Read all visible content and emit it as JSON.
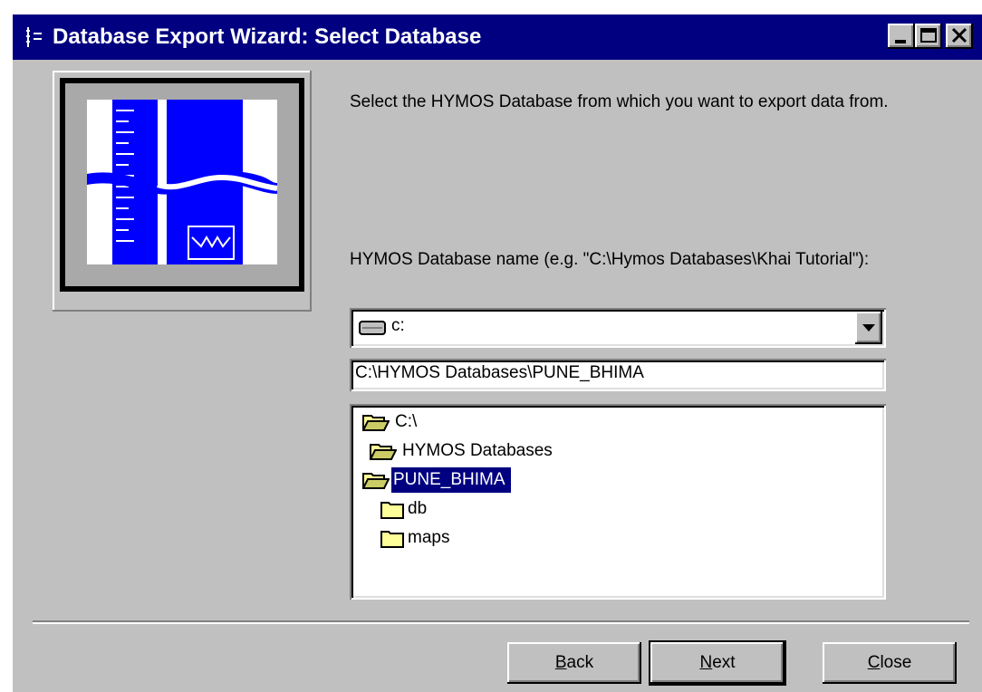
{
  "window": {
    "title": "Database Export Wizard: Select Database",
    "controls": [
      "minimize",
      "maximize",
      "close"
    ]
  },
  "intro_text": "Select the HYMOS Database from which you want to export data from.",
  "db_name_label": "HYMOS Database name (e.g. \"C:\\Hymos Databases\\Khai Tutorial\"):",
  "drive": {
    "icon": "drive-icon",
    "value": "c:"
  },
  "path_value": "C:\\HYMOS Databases\\PUNE_BHIMA",
  "tree": {
    "items": [
      {
        "label": "C:\\",
        "icon": "open-folder-icon",
        "selected": false
      },
      {
        "label": "HYMOS Databases",
        "icon": "open-folder-icon",
        "selected": false
      },
      {
        "label": "PUNE_BHIMA",
        "icon": "open-folder-icon",
        "selected": true
      },
      {
        "label": "db",
        "icon": "closed-folder-icon",
        "selected": false
      },
      {
        "label": "maps",
        "icon": "closed-folder-icon",
        "selected": false
      }
    ]
  },
  "buttons": {
    "back": {
      "mnemonic": "B",
      "rest": "ack"
    },
    "next": {
      "mnemonic": "N",
      "rest": "ext"
    },
    "close": {
      "mnemonic": "C",
      "rest": "lose"
    }
  },
  "colors": {
    "titlebar": "#000080",
    "face": "#c0c0c0",
    "selection": "#000080",
    "logo_blue": "#0000ff"
  }
}
